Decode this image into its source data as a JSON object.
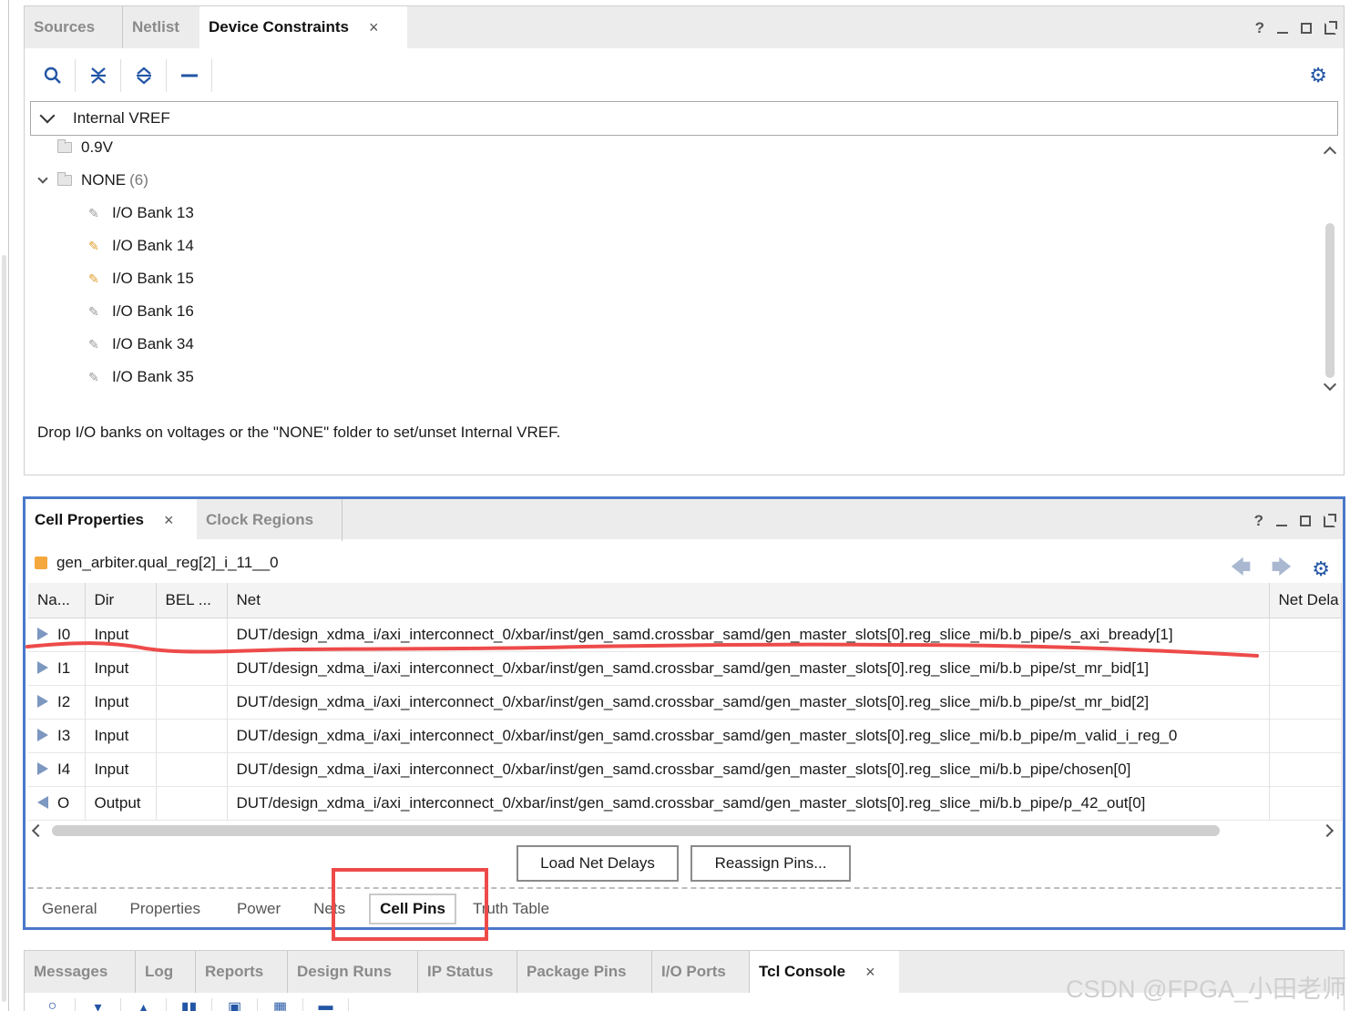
{
  "top_panel": {
    "tabs": [
      {
        "label": "Sources"
      },
      {
        "label": "Netlist"
      },
      {
        "label": "Device Constraints",
        "close": "×"
      }
    ],
    "window_controls": {
      "help": "?"
    },
    "tree_header": "Internal VREF",
    "tree": {
      "voltage": "0.9V",
      "none_label": "NONE",
      "none_count": "(6)",
      "banks": [
        "I/O Bank 13",
        "I/O Bank 14",
        "I/O Bank 15",
        "I/O Bank 16",
        "I/O Bank 34",
        "I/O Bank 35"
      ]
    },
    "hint": "Drop I/O banks on voltages or the \"NONE\" folder to set/unset Internal VREF."
  },
  "cell_panel": {
    "tabs": [
      {
        "label": "Cell Properties",
        "close": "×"
      },
      {
        "label": "Clock Regions"
      }
    ],
    "window_controls": {
      "help": "?"
    },
    "object_name": "gen_arbiter.qual_reg[2]_i_11__0",
    "columns": [
      "Na...",
      "Dir",
      "BEL ...",
      "Net",
      "Net Dela"
    ],
    "rows": [
      {
        "name": "I0",
        "dir": "Input",
        "bel": "",
        "net": "DUT/design_xdma_i/axi_interconnect_0/xbar/inst/gen_samd.crossbar_samd/gen_master_slots[0].reg_slice_mi/b.b_pipe/s_axi_bready[1]",
        "delay": ""
      },
      {
        "name": "I1",
        "dir": "Input",
        "bel": "",
        "net": "DUT/design_xdma_i/axi_interconnect_0/xbar/inst/gen_samd.crossbar_samd/gen_master_slots[0].reg_slice_mi/b.b_pipe/st_mr_bid[1]",
        "delay": ""
      },
      {
        "name": "I2",
        "dir": "Input",
        "bel": "",
        "net": "DUT/design_xdma_i/axi_interconnect_0/xbar/inst/gen_samd.crossbar_samd/gen_master_slots[0].reg_slice_mi/b.b_pipe/st_mr_bid[2]",
        "delay": ""
      },
      {
        "name": "I3",
        "dir": "Input",
        "bel": "",
        "net": "DUT/design_xdma_i/axi_interconnect_0/xbar/inst/gen_samd.crossbar_samd/gen_master_slots[0].reg_slice_mi/b.b_pipe/m_valid_i_reg_0",
        "delay": ""
      },
      {
        "name": "I4",
        "dir": "Input",
        "bel": "",
        "net": "DUT/design_xdma_i/axi_interconnect_0/xbar/inst/gen_samd.crossbar_samd/gen_master_slots[0].reg_slice_mi/b.b_pipe/chosen[0]",
        "delay": ""
      },
      {
        "name": "O",
        "dir": "Output",
        "bel": "",
        "net": "DUT/design_xdma_i/axi_interconnect_0/xbar/inst/gen_samd.crossbar_samd/gen_master_slots[0].reg_slice_mi/b.b_pipe/p_42_out[0]",
        "delay": ""
      }
    ],
    "buttons": {
      "load": "Load Net Delays",
      "reassign": "Reassign Pins..."
    },
    "subtabs": [
      "General",
      "Properties",
      "Power",
      "Nets",
      "Cell Pins",
      "Truth Table"
    ],
    "active_subtab": "Cell Pins"
  },
  "bottom_panel": {
    "tabs": [
      {
        "label": "Messages"
      },
      {
        "label": "Log"
      },
      {
        "label": "Reports"
      },
      {
        "label": "Design Runs"
      },
      {
        "label": "IP Status"
      },
      {
        "label": "Package Pins"
      },
      {
        "label": "I/O Ports"
      },
      {
        "label": "Tcl Console",
        "close": "×"
      }
    ]
  },
  "watermark": "CSDN @FPGA_小田老师",
  "colors": {
    "accent": "#2356a5",
    "highlight_box": "#4a78c9",
    "annotation": "#ee4a4a",
    "object_icon": "#f4a73c"
  }
}
